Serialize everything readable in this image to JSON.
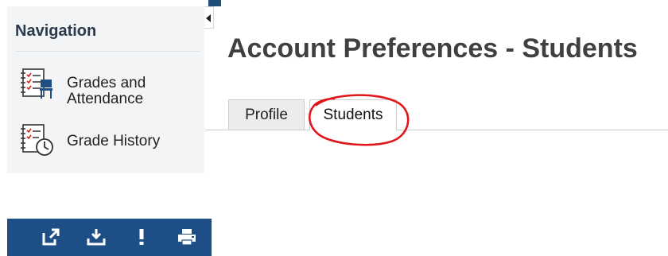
{
  "sidebar": {
    "title": "Navigation",
    "items": [
      {
        "label_line1": "Grades and",
        "label_line2": "Attendance",
        "icon": "grades-attendance-icon"
      },
      {
        "label": "Grade History",
        "icon": "grade-history-icon"
      }
    ]
  },
  "main": {
    "title": "Account Preferences - Students",
    "tabs": [
      {
        "label": "Profile",
        "active": false
      },
      {
        "label": "Students",
        "active": true
      }
    ]
  },
  "toolbar": {
    "buttons": [
      "external-link-icon",
      "download-icon",
      "alert-icon",
      "print-icon"
    ],
    "background": "#1e4e86"
  },
  "colors": {
    "annotation": "#e0161b",
    "sidebar_bg": "#f2f4f6",
    "accent": "#1f4e79"
  }
}
